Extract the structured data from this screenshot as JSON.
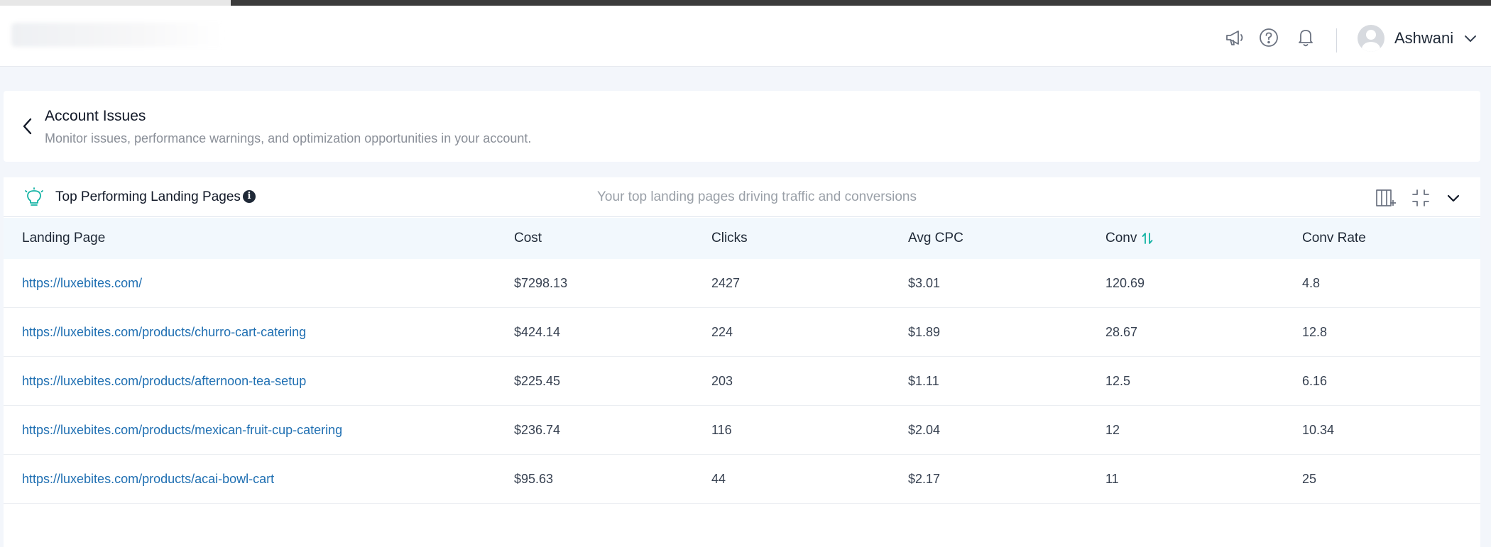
{
  "header": {
    "brand_text": "",
    "user_name": "Ashwani"
  },
  "icons": {
    "announce": "megaphone-icon",
    "help": "help-circle-icon",
    "notifications": "bell-icon",
    "user_menu": "chevron-down-icon"
  },
  "account_issues": {
    "title": "Account Issues",
    "subtitle": "Monitor issues, performance warnings, and optimization opportunities in your account."
  },
  "landing_pages": {
    "title": "Top Performing Landing Pages",
    "description": "Your top landing pages driving traffic and conversions",
    "columns": [
      "Landing Page",
      "Cost",
      "Clicks",
      "Avg CPC",
      "Conv",
      "Conv Rate"
    ],
    "rows": [
      [
        "https://luxebites.com/",
        "$7298.13",
        "2427",
        "$3.01",
        "120.69",
        "4.8"
      ],
      [
        "https://luxebites.com/products/churro-cart-catering",
        "$424.14",
        "224",
        "$1.89",
        "28.67",
        "12.8"
      ],
      [
        "https://luxebites.com/products/afternoon-tea-setup",
        "$225.45",
        "203",
        "$1.11",
        "12.5",
        "6.16"
      ],
      [
        "https://luxebites.com/products/mexican-fruit-cup-catering",
        "$236.74",
        "116",
        "$2.04",
        "12",
        "10.34"
      ],
      [
        "https://luxebites.com/products/acai-bowl-cart",
        "$95.63",
        "44",
        "$2.17",
        "11",
        "25"
      ]
    ]
  },
  "colors": {
    "link": "#1f6fb2",
    "accent_teal": "#13b3a4",
    "header_row_bg": "#f2f8fd"
  }
}
